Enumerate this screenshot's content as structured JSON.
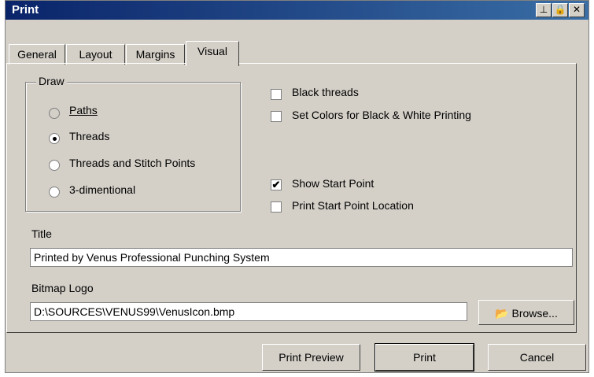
{
  "window": {
    "title": "Print"
  },
  "tabs": [
    {
      "label": "General"
    },
    {
      "label": "Layout"
    },
    {
      "label": "Margins"
    },
    {
      "label": "Visual"
    }
  ],
  "draw": {
    "label": "Draw",
    "options": [
      {
        "label": "Paths",
        "selected": false
      },
      {
        "label": "Threads",
        "selected": true
      },
      {
        "label": "Threads and Stitch Points",
        "selected": false
      },
      {
        "label": "3-dimentional",
        "selected": false
      }
    ]
  },
  "checks": {
    "black_threads": "Black threads",
    "set_colors": "Set Colors for Black & White Printing",
    "show_start": "Show Start Point",
    "print_start": "Print Start Point Location"
  },
  "title_field": {
    "label": "Title",
    "value": "Printed by Venus Professional Punching System"
  },
  "logo_field": {
    "label": "Bitmap Logo",
    "value": "D:\\SOURCES\\VENUS99\\VenusIcon.bmp"
  },
  "buttons": {
    "browse": "Browse...",
    "preview": "Print Preview",
    "print": "Print",
    "cancel": "Cancel"
  }
}
